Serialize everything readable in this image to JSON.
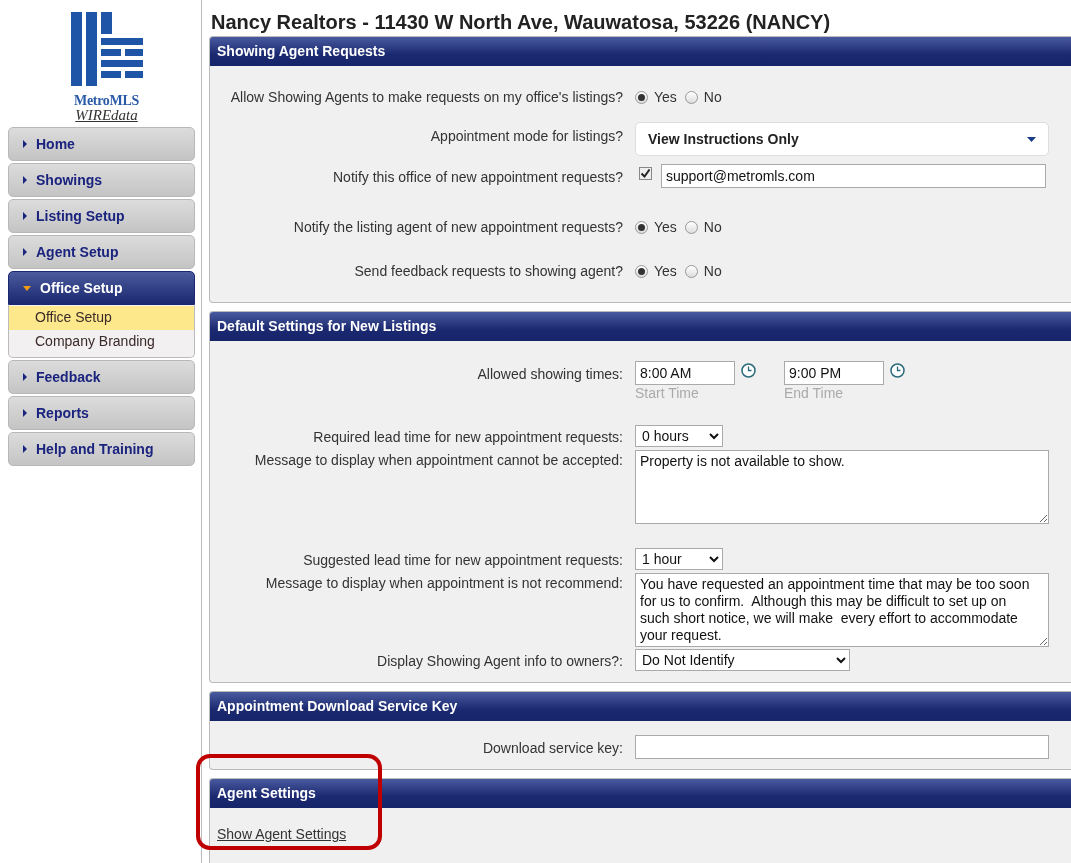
{
  "logo": {
    "name": "MetroMLS",
    "subtitle": "WIREdata"
  },
  "sidebar": {
    "items": [
      {
        "label": "Home",
        "expanded": false
      },
      {
        "label": "Showings",
        "expanded": false
      },
      {
        "label": "Listing Setup",
        "expanded": false
      },
      {
        "label": "Agent Setup",
        "expanded": false
      },
      {
        "label": "Office Setup",
        "expanded": true,
        "children": [
          {
            "label": "Office Setup",
            "selected": true
          },
          {
            "label": "Company Branding",
            "selected": false
          }
        ]
      },
      {
        "label": "Feedback",
        "expanded": false
      },
      {
        "label": "Reports",
        "expanded": false
      },
      {
        "label": "Help and Training",
        "expanded": false
      }
    ]
  },
  "page_title": "Nancy Realtors - 11430 W North Ave, Wauwatosa, 53226 (NANCY)",
  "sections": [
    {
      "title": "Showing Agent Requests",
      "rows": [
        {
          "kind": "radio",
          "label": "Allow Showing Agents to make requests on my office's listings?",
          "options": [
            {
              "label": "Yes",
              "selected": true
            },
            {
              "label": "No",
              "selected": false
            }
          ]
        },
        {
          "kind": "dropdown",
          "label": "Appointment mode for listings?",
          "value": "View Instructions Only"
        },
        {
          "kind": "checkbox_email",
          "label": "Notify this office of new appointment requests?",
          "checked": true,
          "value": "support@metromls.com"
        },
        {
          "kind": "radio",
          "label": "Notify the listing agent of new appointment requests?",
          "options": [
            {
              "label": "Yes",
              "selected": true
            },
            {
              "label": "No",
              "selected": false
            }
          ]
        },
        {
          "kind": "radio",
          "label": "Send feedback requests to showing agent?",
          "options": [
            {
              "label": "Yes",
              "selected": true
            },
            {
              "label": "No",
              "selected": false
            }
          ]
        }
      ]
    },
    {
      "title": "Default Settings for New Listings",
      "rows": [
        {
          "kind": "times",
          "label": "Allowed showing times:",
          "times": [
            {
              "value": "8:00 AM",
              "caption": "Start Time"
            },
            {
              "value": "9:00 PM",
              "caption": "End Time"
            }
          ]
        },
        {
          "kind": "select",
          "label": "Required lead time for new appointment requests:",
          "value": "0 hours"
        },
        {
          "kind": "textarea",
          "label": "Message to display when appointment cannot be accepted:",
          "value": "Property is not available to show."
        },
        {
          "kind": "select",
          "label": "Suggested lead time for new appointment requests:",
          "value": "1 hour"
        },
        {
          "kind": "textarea",
          "label": "Message to display when appointment is not recommend:",
          "value": "You have requested an appointment time that may be too soon for us to confirm.  Although this may be difficult to set up on such short notice, we will make  every effort to accommodate your request."
        },
        {
          "kind": "wide_select",
          "label": "Display Showing Agent info to owners?:",
          "value": "Do Not Identify"
        }
      ]
    },
    {
      "title": "Appointment Download Service Key",
      "rows": [
        {
          "kind": "text",
          "label": "Download service key:"
        }
      ]
    },
    {
      "title": "Agent Settings",
      "rows": [
        {
          "kind": "link",
          "label": "Show Agent Settings"
        }
      ],
      "highlighted": true
    }
  ]
}
